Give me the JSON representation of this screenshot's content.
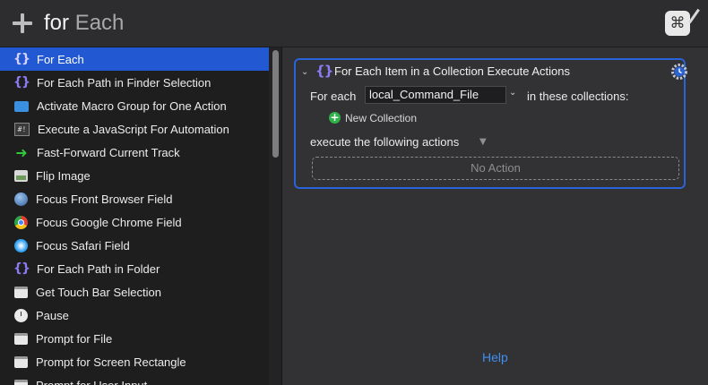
{
  "header": {
    "search_query_part1": "for ",
    "search_query_part2": "Each",
    "app_icon_glyph": "⌘"
  },
  "sidebar": {
    "items": [
      {
        "label": "For Each",
        "icon": "braces-icon",
        "selected": true
      },
      {
        "label": "For Each Path in Finder Selection",
        "icon": "braces-icon"
      },
      {
        "label": "Activate Macro Group for One Action",
        "icon": "folder-icon"
      },
      {
        "label": "Execute a JavaScript For Automation",
        "icon": "terminal-icon"
      },
      {
        "label": "Fast-Forward Current Track",
        "icon": "green-arrow-icon"
      },
      {
        "label": "Flip Image",
        "icon": "photo-icon"
      },
      {
        "label": "Focus Front Browser Field",
        "icon": "globe-icon"
      },
      {
        "label": "Focus Google Chrome Field",
        "icon": "chrome-icon"
      },
      {
        "label": "Focus Safari Field",
        "icon": "safari-icon"
      },
      {
        "label": "For Each Path in Folder",
        "icon": "braces-icon"
      },
      {
        "label": "Get Touch Bar Selection",
        "icon": "window-icon"
      },
      {
        "label": "Pause",
        "icon": "clock-icon"
      },
      {
        "label": "Prompt for File",
        "icon": "window-icon"
      },
      {
        "label": "Prompt for Screen Rectangle",
        "icon": "window-icon"
      },
      {
        "label": "Prompt for User Input",
        "icon": "window-icon"
      }
    ]
  },
  "action": {
    "title": "For Each Item in a Collection Execute Actions",
    "for_each_label": "For each",
    "variable_value": "local_Command_File",
    "collections_label": "in these collections:",
    "new_collection_label": "New Collection",
    "execute_label": "execute the following actions",
    "no_action_label": "No Action"
  },
  "footer": {
    "help_label": "Help"
  },
  "colors": {
    "selection": "#2358d3",
    "action_border": "#2a63d8",
    "link": "#3e8ff0",
    "add_green": "#2fb24a"
  }
}
